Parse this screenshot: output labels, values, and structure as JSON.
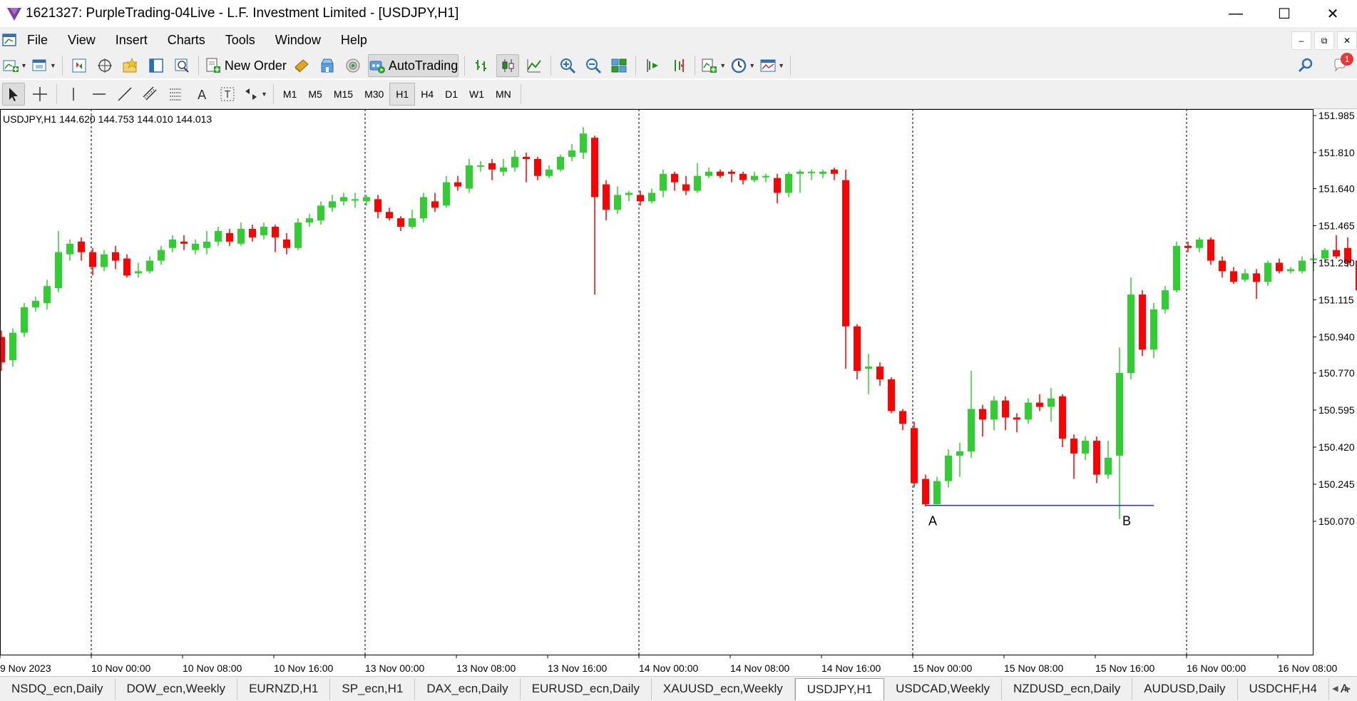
{
  "window": {
    "title": "1621327: PurpleTrading-04Live - L.F. Investment Limited - [USDJPY,H1]",
    "minimize": "—",
    "maximize": "☐",
    "close": "✕"
  },
  "menu": [
    "File",
    "View",
    "Insert",
    "Charts",
    "Tools",
    "Window",
    "Help"
  ],
  "mdi": {
    "minimize": "–",
    "restore": "⧉",
    "close": "✕"
  },
  "toolbar": {
    "new_order_label": "New Order",
    "autotrading_label": "AutoTrading",
    "notification_count": "1"
  },
  "timeframes": [
    "M1",
    "M5",
    "M15",
    "M30",
    "H1",
    "H4",
    "D1",
    "W1",
    "MN"
  ],
  "active_timeframe": "H1",
  "chart": {
    "header": "USDJPY,H1  144.620 144.753 144.010 144.013",
    "bull_color": "#32cd32",
    "bear_color": "#ff0000",
    "level_line_color": "#0000ff",
    "label_a": "A",
    "label_b": "B"
  },
  "tabs": [
    "NSDQ_ecn,Daily",
    "DOW_ecn,Weekly",
    "EURNZD,H1",
    "SP_ecn,H1",
    "DAX_ecn,Daily",
    "EURUSD_ecn,Daily",
    "XAUUSD_ecn,Weekly",
    "USDJPY,H1",
    "USDCAD,Weekly",
    "NZDUSD_ecn,Daily",
    "AUDUSD,Daily",
    "USDCHF,H4",
    "A"
  ],
  "active_tab": "USDJPY,H1",
  "chart_data": {
    "type": "candlestick",
    "symbol": "USDJPY",
    "timeframe": "H1",
    "y_ticks": [
      151.985,
      151.81,
      151.64,
      151.465,
      151.29,
      151.115,
      150.94,
      150.77,
      150.595,
      150.42,
      150.245,
      150.07
    ],
    "x_ticks": [
      "9 Nov 2023",
      "10 Nov 00:00",
      "10 Nov 08:00",
      "10 Nov 16:00",
      "13 Nov 00:00",
      "13 Nov 08:00",
      "13 Nov 16:00",
      "14 Nov 00:00",
      "14 Nov 08:00",
      "14 Nov 16:00",
      "15 Nov 00:00",
      "15 Nov 08:00",
      "15 Nov 16:00",
      "16 Nov 00:00",
      "16 Nov 08:00"
    ],
    "ylim": [
      150.03,
      152.0
    ],
    "level_line": 150.145,
    "candles": [
      [
        150.94,
        150.82,
        150.97,
        150.78
      ],
      [
        150.83,
        150.96,
        150.98,
        150.8
      ],
      [
        150.96,
        151.08,
        151.1,
        150.94
      ],
      [
        151.08,
        151.11,
        151.13,
        151.06
      ],
      [
        151.1,
        151.18,
        151.21,
        151.07
      ],
      [
        151.17,
        151.34,
        151.44,
        151.15
      ],
      [
        151.33,
        151.38,
        151.4,
        151.3
      ],
      [
        151.39,
        151.34,
        151.41,
        151.3
      ],
      [
        151.34,
        151.27,
        151.36,
        151.23
      ],
      [
        151.27,
        151.33,
        151.35,
        151.25
      ],
      [
        151.34,
        151.3,
        151.37,
        151.26
      ],
      [
        151.31,
        151.23,
        151.33,
        151.22
      ],
      [
        151.24,
        151.25,
        151.29,
        151.22
      ],
      [
        151.25,
        151.3,
        151.32,
        151.24
      ],
      [
        151.3,
        151.35,
        151.37,
        151.28
      ],
      [
        151.36,
        151.4,
        151.42,
        151.34
      ],
      [
        151.39,
        151.38,
        151.42,
        151.35
      ],
      [
        151.35,
        151.38,
        151.4,
        151.33
      ],
      [
        151.36,
        151.39,
        151.44,
        151.33
      ],
      [
        151.39,
        151.44,
        151.46,
        151.37
      ],
      [
        151.43,
        151.39,
        151.45,
        151.37
      ],
      [
        151.38,
        151.45,
        151.48,
        151.37
      ],
      [
        151.45,
        151.41,
        151.47,
        151.39
      ],
      [
        151.42,
        151.46,
        151.48,
        151.4
      ],
      [
        151.46,
        151.41,
        151.47,
        151.34
      ],
      [
        151.4,
        151.36,
        151.43,
        151.33
      ],
      [
        151.36,
        151.48,
        151.5,
        151.35
      ],
      [
        151.48,
        151.5,
        151.52,
        151.46
      ],
      [
        151.49,
        151.56,
        151.58,
        151.47
      ],
      [
        151.55,
        151.58,
        151.61,
        151.53
      ],
      [
        151.58,
        151.6,
        151.62,
        151.56
      ],
      [
        151.59,
        151.59,
        151.62,
        151.55
      ],
      [
        151.58,
        151.6,
        151.61,
        151.56
      ],
      [
        151.59,
        151.53,
        151.61,
        151.5
      ],
      [
        151.53,
        151.5,
        151.55,
        151.49
      ],
      [
        151.5,
        151.46,
        151.51,
        151.44
      ],
      [
        151.46,
        151.5,
        151.54,
        151.45
      ],
      [
        151.5,
        151.6,
        151.62,
        151.48
      ],
      [
        151.58,
        151.55,
        151.62,
        151.53
      ],
      [
        151.56,
        151.67,
        151.7,
        151.55
      ],
      [
        151.67,
        151.65,
        151.7,
        151.63
      ],
      [
        151.64,
        151.75,
        151.78,
        151.62
      ],
      [
        151.75,
        151.75,
        151.77,
        151.72
      ],
      [
        151.76,
        151.73,
        151.78,
        151.68
      ],
      [
        151.72,
        151.74,
        151.78,
        151.7
      ],
      [
        151.74,
        151.79,
        151.82,
        151.72
      ],
      [
        151.79,
        151.78,
        151.81,
        151.67
      ],
      [
        151.78,
        151.7,
        151.79,
        151.68
      ],
      [
        151.7,
        151.73,
        151.75,
        151.69
      ],
      [
        151.73,
        151.79,
        151.8,
        151.72
      ],
      [
        151.79,
        151.82,
        151.85,
        151.77
      ],
      [
        151.81,
        151.9,
        151.93,
        151.78
      ],
      [
        151.88,
        151.6,
        151.89,
        151.14
      ],
      [
        151.66,
        151.54,
        151.68,
        151.49
      ],
      [
        151.54,
        151.61,
        151.65,
        151.52
      ],
      [
        151.61,
        151.62,
        151.63,
        151.58
      ],
      [
        151.61,
        151.58,
        151.63,
        151.56
      ],
      [
        151.58,
        151.62,
        151.64,
        151.57
      ],
      [
        151.63,
        151.71,
        151.73,
        151.6
      ],
      [
        151.71,
        151.67,
        151.72,
        151.63
      ],
      [
        151.66,
        151.63,
        151.7,
        151.61
      ],
      [
        151.63,
        151.7,
        151.76,
        151.62
      ],
      [
        151.7,
        151.72,
        151.74,
        151.69
      ],
      [
        151.72,
        151.7,
        151.73,
        151.69
      ],
      [
        151.72,
        151.71,
        151.73,
        151.67
      ],
      [
        151.71,
        151.68,
        151.72,
        151.66
      ],
      [
        151.68,
        151.7,
        151.72,
        151.67
      ],
      [
        151.7,
        151.7,
        151.71,
        151.67
      ],
      [
        151.69,
        151.62,
        151.71,
        151.57
      ],
      [
        151.62,
        151.71,
        151.72,
        151.6
      ],
      [
        151.71,
        151.72,
        151.73,
        151.62
      ],
      [
        151.72,
        151.72,
        151.73,
        151.68
      ],
      [
        151.71,
        151.72,
        151.73,
        151.69
      ],
      [
        151.73,
        151.71,
        151.74,
        151.68
      ],
      [
        151.68,
        150.99,
        151.73,
        150.79
      ],
      [
        150.99,
        150.78,
        151.0,
        150.74
      ],
      [
        150.79,
        150.8,
        150.86,
        150.67
      ],
      [
        150.8,
        150.74,
        150.82,
        150.71
      ],
      [
        150.74,
        150.59,
        150.75,
        150.58
      ],
      [
        150.59,
        150.53,
        150.6,
        150.5
      ],
      [
        150.51,
        150.25,
        150.54,
        150.23
      ],
      [
        150.27,
        150.15,
        150.29,
        150.14
      ],
      [
        150.15,
        150.26,
        150.28,
        150.15
      ],
      [
        150.26,
        150.38,
        150.41,
        150.23
      ],
      [
        150.38,
        150.4,
        150.44,
        150.28
      ],
      [
        150.4,
        150.6,
        150.78,
        150.37
      ],
      [
        150.6,
        150.55,
        150.62,
        150.47
      ],
      [
        150.55,
        150.64,
        150.66,
        150.5
      ],
      [
        150.64,
        150.56,
        150.66,
        150.5
      ],
      [
        150.56,
        150.55,
        150.58,
        150.49
      ],
      [
        150.55,
        150.63,
        150.65,
        150.53
      ],
      [
        150.63,
        150.61,
        150.67,
        150.59
      ],
      [
        150.61,
        150.65,
        150.7,
        150.54
      ],
      [
        150.66,
        150.46,
        150.67,
        150.42
      ],
      [
        150.46,
        150.39,
        150.48,
        150.27
      ],
      [
        150.39,
        150.45,
        150.47,
        150.36
      ],
      [
        150.45,
        150.29,
        150.47,
        150.25
      ],
      [
        150.29,
        150.37,
        150.45,
        150.27
      ],
      [
        150.38,
        150.77,
        150.89,
        150.08
      ],
      [
        150.77,
        151.14,
        151.22,
        150.74
      ],
      [
        151.14,
        150.88,
        151.16,
        150.85
      ],
      [
        150.88,
        151.07,
        151.1,
        150.84
      ],
      [
        151.07,
        151.16,
        151.18,
        151.05
      ],
      [
        151.16,
        151.37,
        151.39,
        151.15
      ],
      [
        151.37,
        151.36,
        151.39,
        151.34
      ],
      [
        151.36,
        151.4,
        151.41,
        151.34
      ],
      [
        151.4,
        151.3,
        151.41,
        151.28
      ],
      [
        151.3,
        151.25,
        151.32,
        151.22
      ],
      [
        151.25,
        151.2,
        151.27,
        151.19
      ],
      [
        151.21,
        151.24,
        151.26,
        151.2
      ],
      [
        151.24,
        151.2,
        151.26,
        151.12
      ],
      [
        151.2,
        151.29,
        151.3,
        151.18
      ],
      [
        151.29,
        151.25,
        151.31,
        151.24
      ],
      [
        151.25,
        151.26,
        151.27,
        151.24
      ],
      [
        151.25,
        151.3,
        151.32,
        151.24
      ],
      [
        151.31,
        151.31,
        151.33,
        151.25
      ],
      [
        151.31,
        151.35,
        151.36,
        151.29
      ],
      [
        151.35,
        151.32,
        151.42,
        151.31
      ],
      [
        151.36,
        151.29,
        151.41,
        151.27
      ],
      [
        151.3,
        151.16,
        151.33,
        151.12
      ]
    ]
  }
}
